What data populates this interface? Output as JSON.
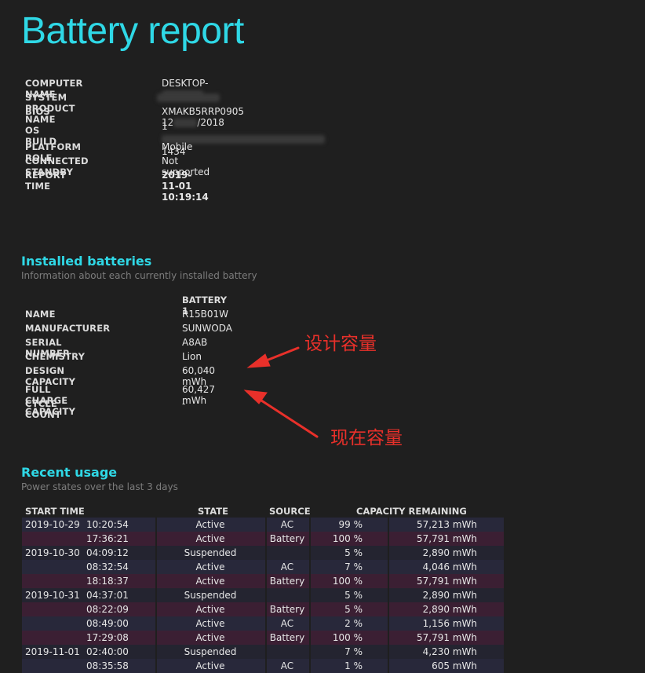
{
  "title": "Battery report",
  "system": [
    {
      "key": "COMPUTER NAME",
      "value": "DESKTOP-",
      "redacted": true
    },
    {
      "key": "SYSTEM PRODUCT NAME",
      "value": "",
      "redacted": true
    },
    {
      "key": "BIOS",
      "value": "XMAKB5RRP0905 12",
      "suffix": "/2018",
      "redacted": true
    },
    {
      "key": "OS BUILD",
      "value": "1",
      "value2": "1434",
      "redacted": true
    },
    {
      "key": "PLATFORM ROLE",
      "value": "Mobile"
    },
    {
      "key": "CONNECTED STANDBY",
      "value": "Not supported"
    },
    {
      "key": "REPORT TIME",
      "value": "2019-11-01  10:19:14"
    }
  ],
  "installed": {
    "title": "Installed batteries",
    "subtitle": "Information about each currently installed battery",
    "column": "BATTERY 1",
    "rows": [
      {
        "key": "NAME",
        "value": "R15B01W"
      },
      {
        "key": "MANUFACTURER",
        "value": "SUNWODA"
      },
      {
        "key": "SERIAL NUMBER",
        "value": "A8AB"
      },
      {
        "key": "CHEMISTRY",
        "value": "Lion"
      },
      {
        "key": "DESIGN CAPACITY",
        "value": "60,040 mWh"
      },
      {
        "key": "FULL CHARGE CAPACITY",
        "value": "60,427 mWh"
      },
      {
        "key": "CYCLE COUNT",
        "value": "-"
      }
    ]
  },
  "annotations": {
    "design": "设计容量",
    "current": "现在容量",
    "color": "#e8302a"
  },
  "usage": {
    "title": "Recent usage",
    "subtitle": "Power states over the last 3 days",
    "headers": {
      "start": "START TIME",
      "state": "STATE",
      "source": "SOURCE",
      "capacity": "CAPACITY REMAINING"
    },
    "rows": [
      {
        "date": "2019-10-29",
        "time": "10:20:54",
        "state": "Active",
        "source": "AC",
        "pct": "99 %",
        "cap": "57,213 mWh",
        "style": "a"
      },
      {
        "date": "",
        "time": "17:36:21",
        "state": "Active",
        "source": "Battery",
        "pct": "100 %",
        "cap": "57,791 mWh",
        "style": "b"
      },
      {
        "date": "2019-10-30",
        "time": "04:09:12",
        "state": "Suspended",
        "source": "",
        "pct": "5 %",
        "cap": "2,890 mWh",
        "style": "c"
      },
      {
        "date": "",
        "time": "08:32:54",
        "state": "Active",
        "source": "AC",
        "pct": "7 %",
        "cap": "4,046 mWh",
        "style": "a"
      },
      {
        "date": "",
        "time": "18:18:37",
        "state": "Active",
        "source": "Battery",
        "pct": "100 %",
        "cap": "57,791 mWh",
        "style": "b"
      },
      {
        "date": "2019-10-31",
        "time": "04:37:01",
        "state": "Suspended",
        "source": "",
        "pct": "5 %",
        "cap": "2,890 mWh",
        "style": "c"
      },
      {
        "date": "",
        "time": "08:22:09",
        "state": "Active",
        "source": "Battery",
        "pct": "5 %",
        "cap": "2,890 mWh",
        "style": "b"
      },
      {
        "date": "",
        "time": "08:49:00",
        "state": "Active",
        "source": "AC",
        "pct": "2 %",
        "cap": "1,156 mWh",
        "style": "a"
      },
      {
        "date": "",
        "time": "17:29:08",
        "state": "Active",
        "source": "Battery",
        "pct": "100 %",
        "cap": "57,791 mWh",
        "style": "b"
      },
      {
        "date": "2019-11-01",
        "time": "02:40:00",
        "state": "Suspended",
        "source": "",
        "pct": "7 %",
        "cap": "4,230 mWh",
        "style": "c"
      },
      {
        "date": "",
        "time": "08:35:58",
        "state": "Active",
        "source": "AC",
        "pct": "1 %",
        "cap": "605 mWh",
        "style": "a"
      }
    ]
  },
  "colors": {
    "accent": "#2fd8e6",
    "background": "#1f1f1f"
  }
}
